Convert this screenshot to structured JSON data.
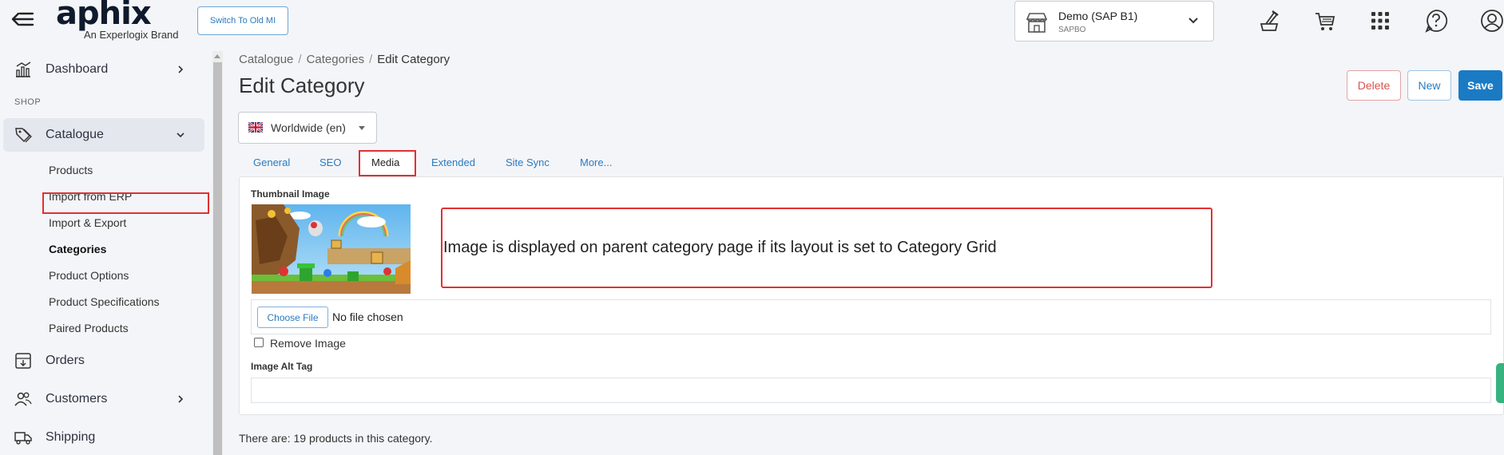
{
  "header": {
    "logo_text": "aphix",
    "logo_subtitle": "An Experlogix Brand",
    "switch_button": "Switch To Old MI",
    "store": {
      "name": "Demo (SAP B1)",
      "code": "SAPBO"
    },
    "icons": [
      "brush-cart-icon",
      "cart-icon",
      "apps-grid-icon",
      "help-icon",
      "user-account-icon"
    ]
  },
  "sidebar": {
    "dashboard": "Dashboard",
    "section_shop": "SHOP",
    "catalogue": "Catalogue",
    "sub_items": [
      "Products",
      "Import from ERP",
      "Import & Export",
      "Categories",
      "Product Options",
      "Product Specifications",
      "Paired Products"
    ],
    "orders": "Orders",
    "customers": "Customers",
    "shipping": "Shipping"
  },
  "breadcrumb": [
    "Catalogue",
    "Categories",
    "Edit Category"
  ],
  "page": {
    "title": "Edit Category",
    "buttons": {
      "delete": "Delete",
      "new": "New",
      "save": "Save"
    },
    "language": "Worldwide (en)"
  },
  "tabs": [
    "General",
    "SEO",
    "Media",
    "Extended",
    "Site Sync",
    "More..."
  ],
  "active_tab": "Media",
  "media": {
    "thumbnail_label": "Thumbnail Image",
    "callout": "Image is displayed on parent category page if its layout is set to Category Grid",
    "choose_file": "Choose File",
    "file_status": "No file chosen",
    "remove_image": "Remove Image",
    "alt_tag_label": "Image Alt Tag",
    "alt_tag_value": ""
  },
  "footer_note": "There are: 19 products in this category.",
  "colors": {
    "accent": "#1a7bc4",
    "danger": "#d9534f",
    "highlight": "#e03131"
  }
}
